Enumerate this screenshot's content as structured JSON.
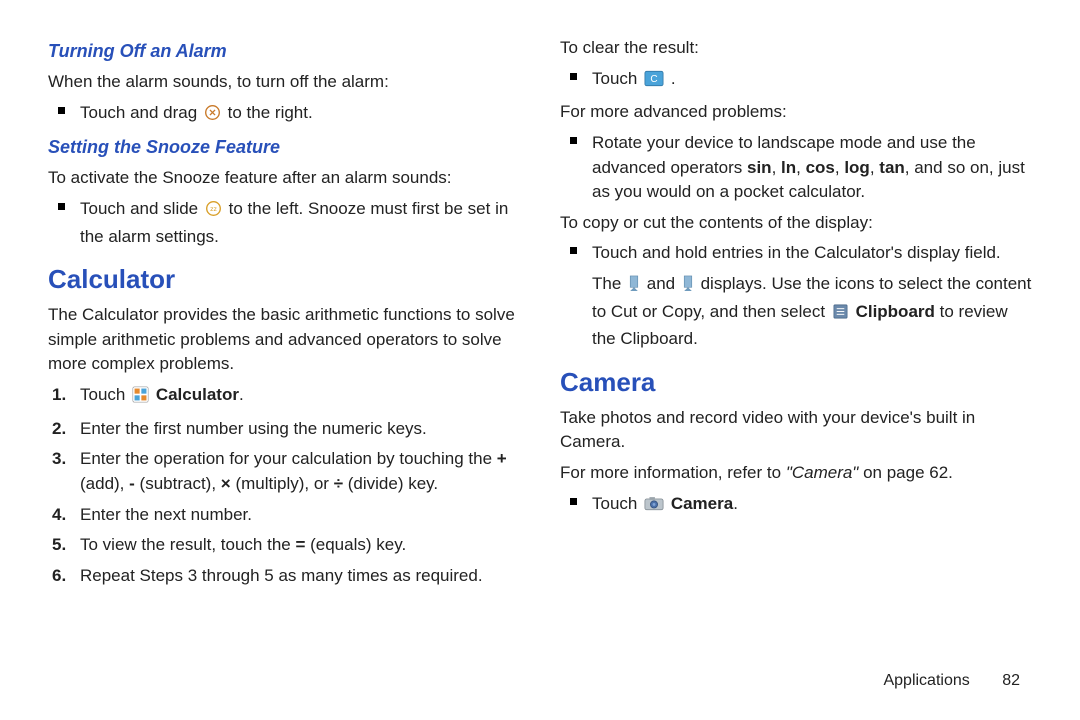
{
  "left": {
    "h1": "Turning Off an Alarm",
    "p1": "When the alarm sounds, to turn off the alarm:",
    "b1a": "Touch and drag ",
    "b1b": " to the right.",
    "h2": "Setting the Snooze Feature",
    "p2": "To activate the Snooze feature after an alarm sounds:",
    "b2a": "Touch and slide ",
    "b2b": " to the left. Snooze must first be set in the alarm settings.",
    "h3": "Calculator",
    "p3": "The Calculator provides the basic arithmetic functions to solve simple arithmetic problems and advanced operators to solve more complex problems.",
    "ol": {
      "n1": "1.",
      "t1a": "Touch ",
      "t1b": "Calculator",
      "t1c": ".",
      "n2": "2.",
      "t2": "Enter the first number using the numeric keys.",
      "n3": "3.",
      "t3a": "Enter the operation for your calculation by touching the ",
      "t3b": "+",
      "t3c": " (add), ",
      "t3d": "-",
      "t3e": " (subtract), ",
      "t3f": "×",
      "t3g": " (multiply), or ",
      "t3h": "÷",
      "t3i": " (divide) key.",
      "n4": "4.",
      "t4": "Enter the next number.",
      "n5": "5.",
      "t5a": "To view the result, touch the ",
      "t5b": "=",
      "t5c": " (equals) key.",
      "n6": "6.",
      "t6": "Repeat Steps 3 through 5 as many times as required."
    }
  },
  "right": {
    "p1": "To clear the result:",
    "b1a": "Touch ",
    "b1b": ".",
    "p2": "For more advanced problems:",
    "b2a": "Rotate your device to landscape mode and use the advanced operators ",
    "b2_ops": [
      "sin",
      "ln",
      "cos",
      "log",
      "tan"
    ],
    "b2b": ", and so on, just as you would on a pocket calculator.",
    "p3": "To copy or cut the contents of the display:",
    "b3": "Touch and hold entries in the Calculator's display field.",
    "b3_line2a": "The ",
    "b3_line2b": " and ",
    "b3_line2c": " displays. Use the icons to select the content to Cut or Copy, and then select ",
    "b3_clip": "Clipboard",
    "b3_line2d": " to review the Clipboard.",
    "h4": "Camera",
    "p4": "Take photos and record video with your device's built in Camera.",
    "p5a": "For more information, refer to ",
    "p5b": "\"Camera\"",
    "p5c": " on page 62.",
    "b4a": "Touch ",
    "b4b": "Camera",
    "b4c": "."
  },
  "footer": {
    "section": "Applications",
    "page": "82"
  }
}
